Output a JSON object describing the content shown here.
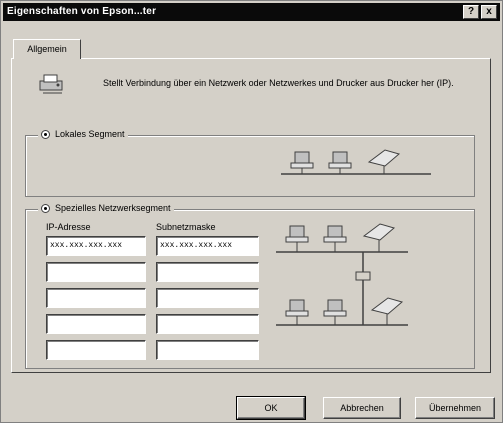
{
  "window": {
    "title": "Eigenschaften von Epson...ter",
    "help_label": "?",
    "close_label": "x"
  },
  "tabs": [
    {
      "label": "Allgemein"
    }
  ],
  "intro_text": "Stellt Verbindung über ein Netzwerk oder Netzwerkes und Drucker aus Drucker her (IP).",
  "local_group": {
    "label": "Lokales Segment",
    "selected": true
  },
  "special_group": {
    "label": "Spezielles Netzwerksegment",
    "selected": true,
    "col_ip": "IP-Adresse",
    "col_mask": "Subnetzmaske",
    "rows": [
      {
        "ip": "xxx.xxx.xxx.xxx",
        "mask": "xxx.xxx.xxx.xxx"
      },
      {
        "ip": "",
        "mask": ""
      },
      {
        "ip": "",
        "mask": ""
      },
      {
        "ip": "",
        "mask": ""
      },
      {
        "ip": "",
        "mask": ""
      }
    ]
  },
  "buttons": {
    "ok": "OK",
    "cancel": "Abbrechen",
    "apply": "Übernehmen"
  },
  "icons": [
    "printer-network-icon",
    "computer-icon",
    "printer-icon"
  ]
}
